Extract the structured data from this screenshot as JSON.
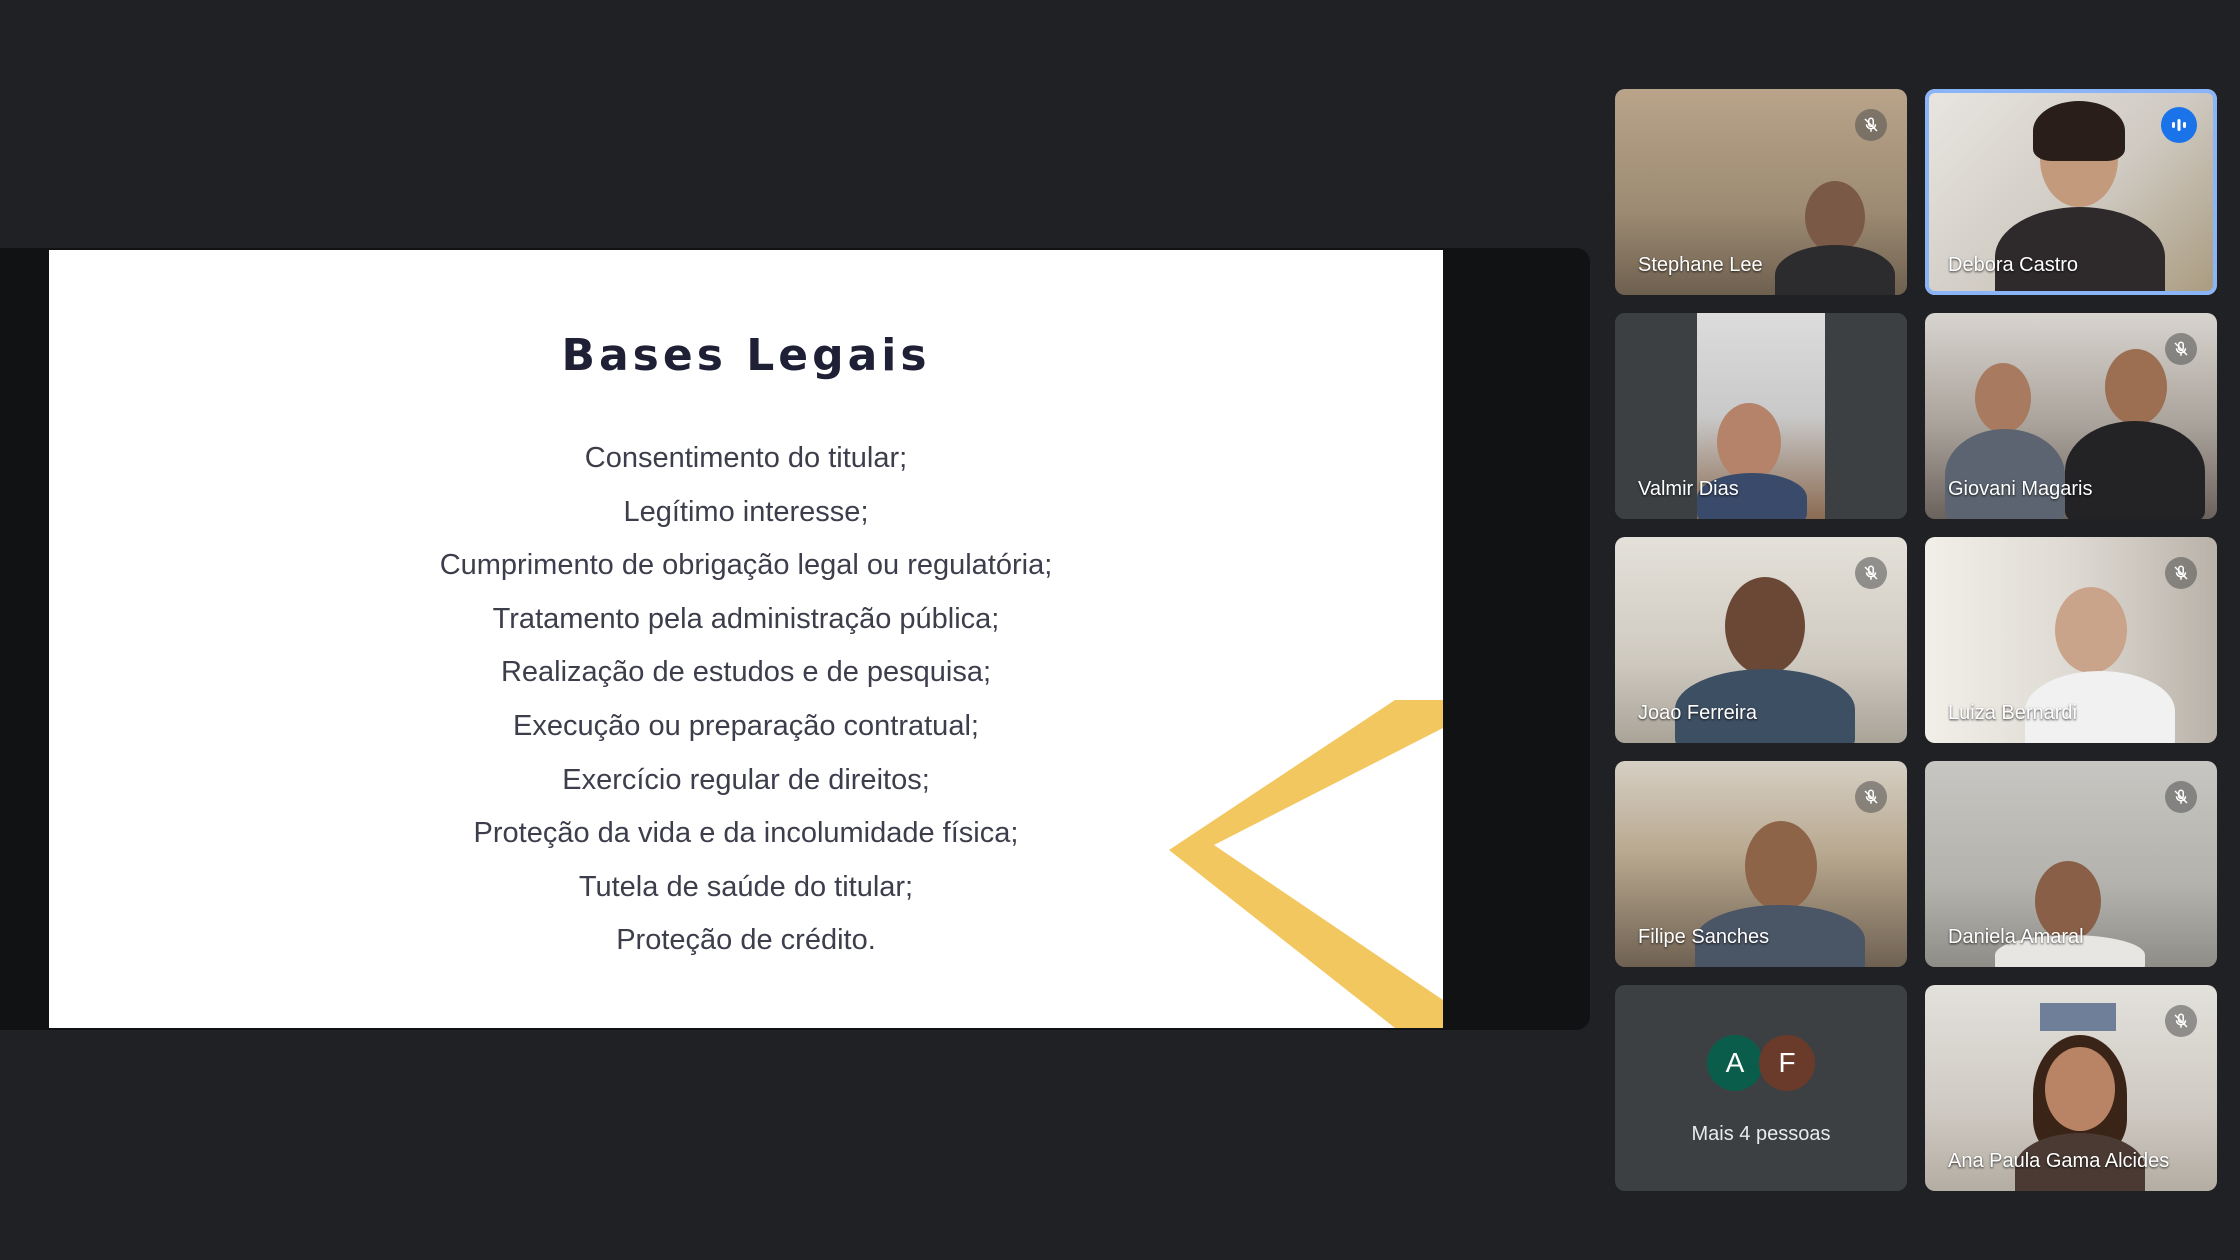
{
  "presentation": {
    "title": "Bases Legais",
    "lines": [
      "Consentimento do titular;",
      "Legítimo interesse;",
      "Cumprimento de obrigação legal ou regulatória;",
      "Tratamento pela administração pública;",
      "Realização de estudos e de pesquisa;",
      "Execução ou preparação contratual;",
      "Exercício regular de direitos;",
      "Proteção da vida e da incolumidade física;",
      "Tutela de saúde do titular;",
      "Proteção de crédito."
    ],
    "accent_color": "#f2c14e"
  },
  "participants": [
    {
      "name": "Stephane Lee",
      "muted": true
    },
    {
      "name": "Debora Castro",
      "muted": false,
      "speaking": true
    },
    {
      "name": "Valmir Dias",
      "muted": false
    },
    {
      "name": "Giovani Magaris",
      "muted": true
    },
    {
      "name": "Joao Ferreira",
      "muted": true
    },
    {
      "name": "Luiza Bernardi",
      "muted": true
    },
    {
      "name": "Filipe Sanches",
      "muted": true
    },
    {
      "name": "Daniela Amaral",
      "muted": true
    },
    {
      "name": "Ana Paula Gama Alcides",
      "muted": true
    }
  ],
  "more": {
    "label": "Mais 4 pessoas",
    "avatars": [
      {
        "letter": "A",
        "color": "#0b5d4b"
      },
      {
        "letter": "F",
        "color": "#6a3b2a"
      }
    ]
  },
  "colors": {
    "background": "#202124",
    "speaking_indicator": "#1a73e8",
    "tile_border_active": "#8ab4f8"
  }
}
